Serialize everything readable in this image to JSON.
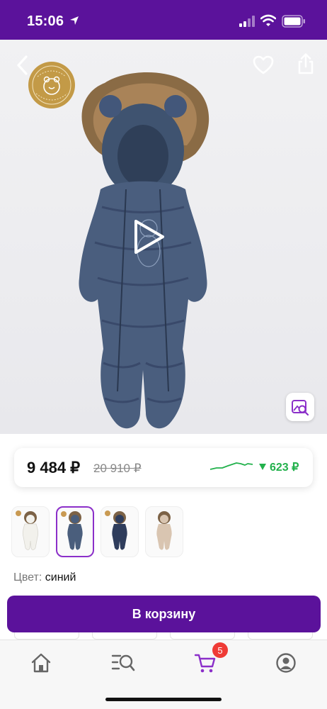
{
  "status_bar": {
    "time": "15:06"
  },
  "hero": {
    "badge_text": "I место · Золотой медвежонок · 2021",
    "icons": [
      "back-arrow-icon",
      "heart-icon",
      "share-icon",
      "play-icon",
      "image-search-icon"
    ]
  },
  "price": {
    "current": "9 484 ₽",
    "old": "20 910 ₽",
    "drop": "623 ₽",
    "drop_color": "#22b14c"
  },
  "thumbnails": [
    {
      "color_name": "white",
      "suit_color": "#f2f1ec",
      "selected": false
    },
    {
      "color_name": "blue",
      "suit_color": "#4a5e7c",
      "selected": true
    },
    {
      "color_name": "navy",
      "suit_color": "#2f3d5c",
      "selected": false
    },
    {
      "color_name": "beige",
      "suit_color": "#d9c5b1",
      "selected": false
    }
  ],
  "color": {
    "label": "Цвет:",
    "value": "синий"
  },
  "cart_button": {
    "label": "В корзину"
  },
  "bottom_nav": {
    "items": [
      "home-icon",
      "catalog-search-icon",
      "cart-icon",
      "profile-icon"
    ],
    "cart_count": "5",
    "accent": "#8b2fc9"
  },
  "colors": {
    "brand": "#5b129b",
    "accent": "#8b2fc9",
    "badge": "#ef3b36"
  }
}
